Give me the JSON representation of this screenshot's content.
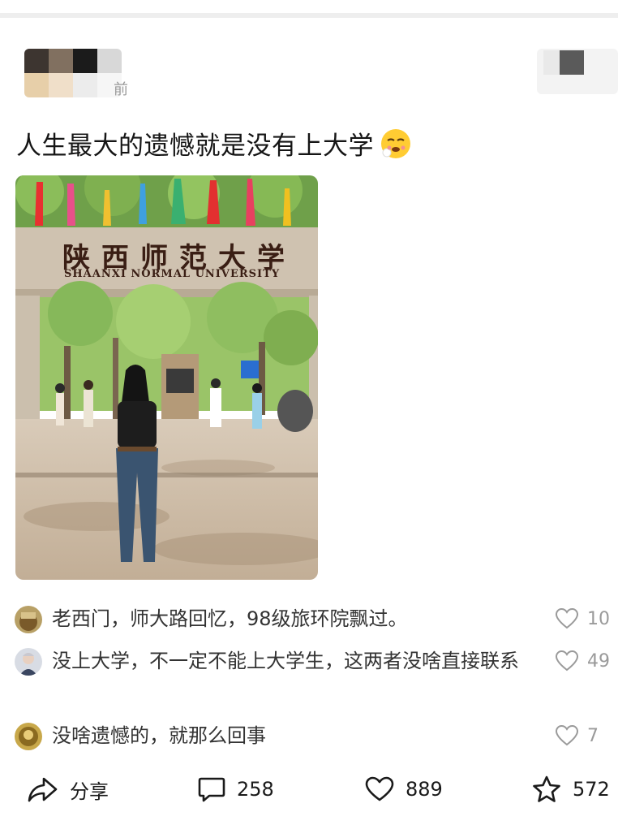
{
  "author": {
    "time_suffix": "前"
  },
  "post": {
    "title": "人生最大的遗憾就是没有上大学"
  },
  "photo": {
    "sign_cn": "陕西师范大学",
    "sign_en": "SHAANXI NORMAL UNIVERSITY"
  },
  "comments": [
    {
      "text": "老西门，师大路回忆，98级旅环院飘过。",
      "likes": "10"
    },
    {
      "text": "没上大学，不一定不能上大学生，这两者没啥直接联系",
      "likes": "49"
    },
    {
      "text": "没啥遗憾的，就那么回事",
      "likes": "7"
    }
  ],
  "actions": {
    "share_label": "分享",
    "comment_count": "258",
    "like_count": "889",
    "favorite_count": "572"
  },
  "colors": {
    "text_primary": "#151515",
    "text_secondary": "#9a9a9a",
    "comment_text": "#333333"
  }
}
